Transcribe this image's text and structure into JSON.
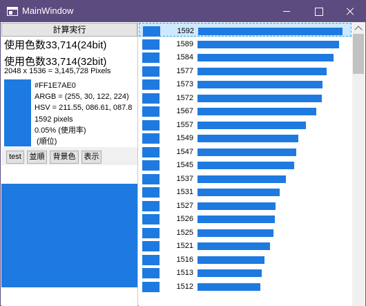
{
  "window": {
    "title": "MainWindow"
  },
  "left": {
    "calc_button": "計算実行",
    "count24": "使用色数33,714(24bit)",
    "count32": "使用色数33,714(32bit)",
    "pixels_line": "2048 x 1536 = 3,145,728 Pixels",
    "selected_color": {
      "hex": "#FF1E7AE0",
      "argb": "ARGB = (255, 30, 122, 224)",
      "hsv": "HSV = 211.55, 086.61, 087.8",
      "pixels": "1592 pixels",
      "usage": "0.05% (使用率)",
      "rank": " (順位)"
    },
    "buttons": {
      "test": "test",
      "sort": "並順",
      "bg": "背景色",
      "show": "表示"
    }
  },
  "list": {
    "color": "#1e7ae0",
    "rows": [
      {
        "count": "1592",
        "value": 1592
      },
      {
        "count": "1589",
        "value": 1589
      },
      {
        "count": "1584",
        "value": 1584
      },
      {
        "count": "1577",
        "value": 1577
      },
      {
        "count": "1573",
        "value": 1573
      },
      {
        "count": "1572",
        "value": 1572
      },
      {
        "count": "1567",
        "value": 1567
      },
      {
        "count": "1557",
        "value": 1557
      },
      {
        "count": "1549",
        "value": 1549
      },
      {
        "count": "1547",
        "value": 1547
      },
      {
        "count": "1545",
        "value": 1545
      },
      {
        "count": "1537",
        "value": 1537
      },
      {
        "count": "1531",
        "value": 1531
      },
      {
        "count": "1527",
        "value": 1527
      },
      {
        "count": "1526",
        "value": 1526
      },
      {
        "count": "1525",
        "value": 1525
      },
      {
        "count": "1521",
        "value": 1521
      },
      {
        "count": "1516",
        "value": 1516
      },
      {
        "count": "1513",
        "value": 1513
      },
      {
        "count": "1512",
        "value": 1512
      }
    ]
  }
}
